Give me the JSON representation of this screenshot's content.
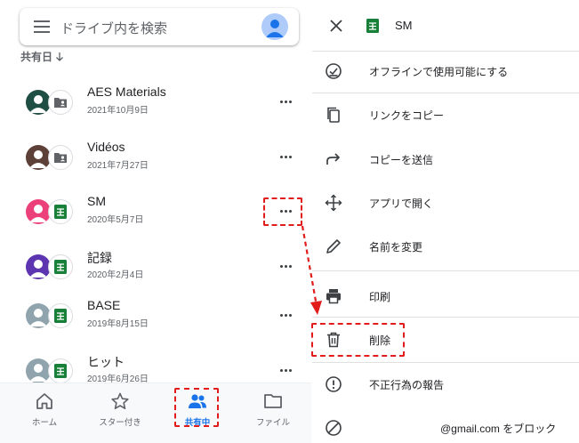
{
  "search": {
    "placeholder": "ドライブ内を検索"
  },
  "sort": {
    "label": "共有日"
  },
  "files": [
    {
      "name": "AES Materials",
      "date": "2021年10月9日",
      "type": "shared-folder",
      "avatar_color": "#1f4e45"
    },
    {
      "name": "Vidéos",
      "date": "2021年7月27日",
      "type": "shared-folder",
      "avatar_color": "#5d4037"
    },
    {
      "name": "SM",
      "date": "2020年5月7日",
      "type": "sheets",
      "avatar_color": "#ec407a"
    },
    {
      "name": "記録",
      "date": "2020年2月4日",
      "type": "sheets",
      "avatar_color": "#5e35b1"
    },
    {
      "name": "BASE",
      "date": "2019年8月15日",
      "type": "sheets",
      "avatar_color": "#90a4ae"
    },
    {
      "name": "ヒット",
      "date": "2019年6月26日",
      "type": "sheets",
      "avatar_color": "#90a4ae"
    }
  ],
  "bottom_nav": [
    {
      "label": "ホーム",
      "icon": "home-icon"
    },
    {
      "label": "スター付き",
      "icon": "star-icon"
    },
    {
      "label": "共有中",
      "icon": "people-icon",
      "active": true
    },
    {
      "label": "ファイル",
      "icon": "folder-icon"
    }
  ],
  "sheet": {
    "title": "SM",
    "actions": [
      {
        "label": "オフラインで使用可能にする",
        "icon": "offline-check-icon"
      },
      {
        "label": "リンクをコピー",
        "icon": "copy-icon"
      },
      {
        "label": "コピーを送信",
        "icon": "share-arrow-icon"
      },
      {
        "label": "アプリで開く",
        "icon": "move-arrows-icon"
      },
      {
        "label": "名前を変更",
        "icon": "pencil-icon"
      },
      {
        "label": "印刷",
        "icon": "printer-icon"
      },
      {
        "label": "削除",
        "icon": "trash-icon"
      },
      {
        "label": "不正行為の報告",
        "icon": "report-icon"
      },
      {
        "label": "@gmail.com をブロック",
        "icon": "block-icon"
      }
    ]
  },
  "colors": {
    "accent": "#1a73e8",
    "sheets_green": "#188038",
    "annotation_red": "#e21b1b"
  }
}
